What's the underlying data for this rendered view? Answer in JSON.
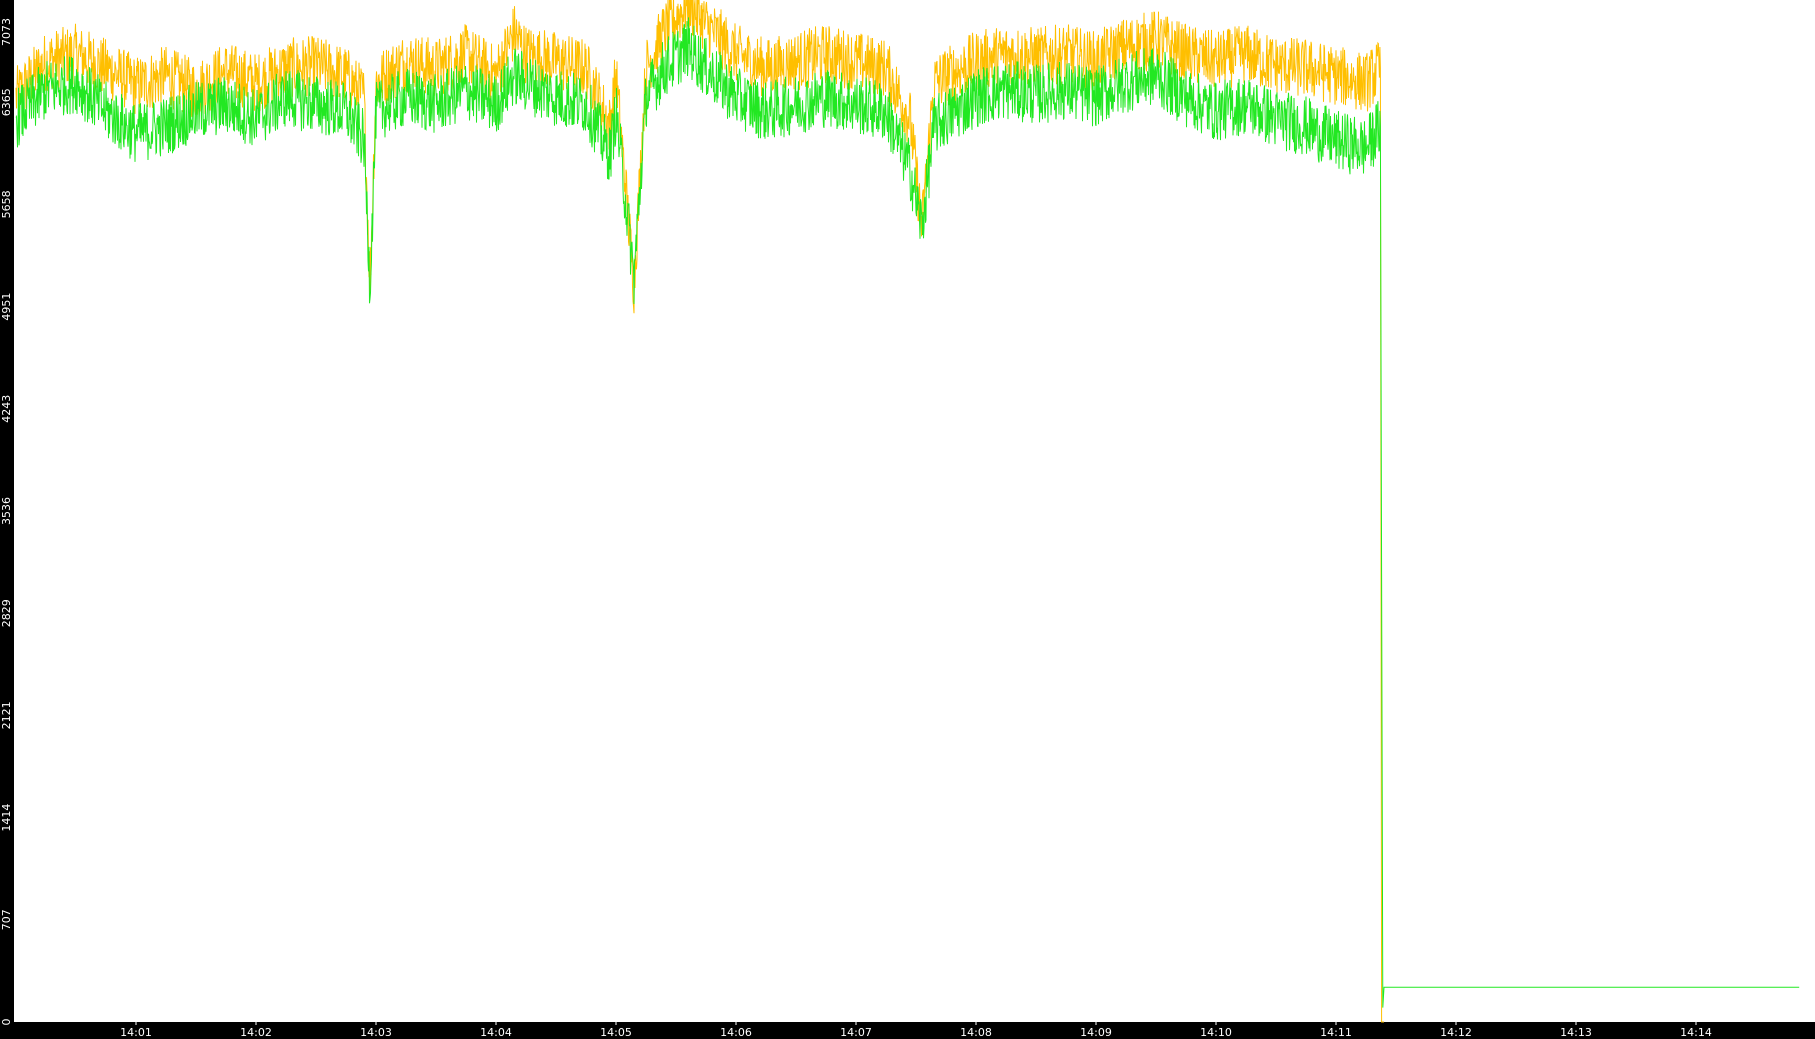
{
  "chart_data": {
    "type": "line",
    "title": "",
    "xlabel": "",
    "ylabel": "",
    "ylim": [
      0,
      7073
    ],
    "xlim_minutes": [
      0.0,
      14.86
    ],
    "yticks": [
      "0",
      "707",
      "1414",
      "2121",
      "2829",
      "3536",
      "4243",
      "4951",
      "5658",
      "6365",
      "7073"
    ],
    "xticks": [
      {
        "label": "14:01",
        "t": 1
      },
      {
        "label": "14:02",
        "t": 2
      },
      {
        "label": "14:03",
        "t": 3
      },
      {
        "label": "14:04",
        "t": 4
      },
      {
        "label": "14:05",
        "t": 5
      },
      {
        "label": "14:06",
        "t": 6
      },
      {
        "label": "14:07",
        "t": 7
      },
      {
        "label": "14:08",
        "t": 8
      },
      {
        "label": "14:09",
        "t": 9
      },
      {
        "label": "14:10",
        "t": 10
      },
      {
        "label": "14:11",
        "t": 11
      },
      {
        "label": "14:12",
        "t": 12
      },
      {
        "label": "14:13",
        "t": 13
      },
      {
        "label": "14:14",
        "t": 14
      }
    ],
    "grid": false,
    "legend": "none",
    "series": [
      {
        "color": "#ffbf00",
        "points": [
          [
            0.0,
            6400
          ],
          [
            0.25,
            6650
          ],
          [
            0.5,
            6700
          ],
          [
            0.75,
            6600
          ],
          [
            1.0,
            6480
          ],
          [
            1.25,
            6550
          ],
          [
            1.5,
            6450
          ],
          [
            1.75,
            6580
          ],
          [
            2.0,
            6500
          ],
          [
            2.25,
            6600
          ],
          [
            2.5,
            6620
          ],
          [
            2.75,
            6550
          ],
          [
            2.9,
            6400
          ],
          [
            2.95,
            5100
          ],
          [
            3.0,
            6500
          ],
          [
            3.25,
            6650
          ],
          [
            3.5,
            6600
          ],
          [
            3.75,
            6700
          ],
          [
            4.0,
            6550
          ],
          [
            4.15,
            6850
          ],
          [
            4.25,
            6700
          ],
          [
            4.5,
            6650
          ],
          [
            4.75,
            6600
          ],
          [
            4.95,
            6200
          ],
          [
            5.0,
            6550
          ],
          [
            5.15,
            5100
          ],
          [
            5.25,
            6600
          ],
          [
            5.4,
            6850
          ],
          [
            5.6,
            7050
          ],
          [
            5.75,
            6900
          ],
          [
            6.0,
            6700
          ],
          [
            6.25,
            6600
          ],
          [
            6.5,
            6650
          ],
          [
            6.75,
            6700
          ],
          [
            7.0,
            6650
          ],
          [
            7.25,
            6600
          ],
          [
            7.45,
            6250
          ],
          [
            7.55,
            5500
          ],
          [
            7.65,
            6500
          ],
          [
            8.0,
            6650
          ],
          [
            8.25,
            6700
          ],
          [
            8.5,
            6680
          ],
          [
            8.75,
            6700
          ],
          [
            9.0,
            6650
          ],
          [
            9.25,
            6750
          ],
          [
            9.5,
            6800
          ],
          [
            9.75,
            6700
          ],
          [
            10.0,
            6650
          ],
          [
            10.25,
            6700
          ],
          [
            10.5,
            6620
          ],
          [
            10.75,
            6600
          ],
          [
            11.0,
            6550
          ],
          [
            11.25,
            6500
          ],
          [
            11.37,
            6600
          ],
          [
            11.38,
            0
          ],
          [
            11.4,
            0
          ]
        ]
      },
      {
        "color": "#22e822",
        "points": [
          [
            0.0,
            6250
          ],
          [
            0.25,
            6450
          ],
          [
            0.5,
            6500
          ],
          [
            0.75,
            6300
          ],
          [
            1.0,
            6150
          ],
          [
            1.25,
            6200
          ],
          [
            1.5,
            6300
          ],
          [
            1.75,
            6350
          ],
          [
            2.0,
            6250
          ],
          [
            2.25,
            6400
          ],
          [
            2.5,
            6350
          ],
          [
            2.75,
            6300
          ],
          [
            2.9,
            6100
          ],
          [
            2.95,
            5100
          ],
          [
            3.0,
            6300
          ],
          [
            3.25,
            6400
          ],
          [
            3.5,
            6350
          ],
          [
            3.75,
            6450
          ],
          [
            4.0,
            6350
          ],
          [
            4.15,
            6550
          ],
          [
            4.25,
            6500
          ],
          [
            4.5,
            6400
          ],
          [
            4.75,
            6350
          ],
          [
            4.95,
            6000
          ],
          [
            5.0,
            6300
          ],
          [
            5.15,
            5150
          ],
          [
            5.25,
            6400
          ],
          [
            5.4,
            6600
          ],
          [
            5.6,
            6750
          ],
          [
            5.75,
            6600
          ],
          [
            6.0,
            6400
          ],
          [
            6.25,
            6300
          ],
          [
            6.5,
            6350
          ],
          [
            6.75,
            6400
          ],
          [
            7.0,
            6350
          ],
          [
            7.25,
            6300
          ],
          [
            7.45,
            5900
          ],
          [
            7.55,
            5500
          ],
          [
            7.65,
            6200
          ],
          [
            8.0,
            6400
          ],
          [
            8.25,
            6450
          ],
          [
            8.5,
            6420
          ],
          [
            8.75,
            6450
          ],
          [
            9.0,
            6400
          ],
          [
            9.25,
            6500
          ],
          [
            9.5,
            6550
          ],
          [
            9.75,
            6400
          ],
          [
            10.0,
            6300
          ],
          [
            10.25,
            6350
          ],
          [
            10.5,
            6250
          ],
          [
            10.75,
            6200
          ],
          [
            11.0,
            6100
          ],
          [
            11.25,
            6050
          ],
          [
            11.37,
            6200
          ],
          [
            11.38,
            3100
          ],
          [
            11.39,
            100
          ],
          [
            11.4,
            240
          ],
          [
            14.86,
            240
          ]
        ]
      }
    ]
  }
}
